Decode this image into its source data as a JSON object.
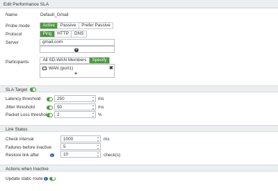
{
  "window": {
    "title": "Edit Performance SLA"
  },
  "form": {
    "name_label": "Name",
    "name_value": "Default_Gmail",
    "probe_mode": {
      "label": "Probe mode",
      "options": [
        "Active",
        "Passive",
        "Prefer Passive"
      ],
      "selected": "Active"
    },
    "protocol": {
      "label": "Protocol",
      "options": [
        "Ping",
        "HTTP",
        "DNS"
      ],
      "selected": "Ping"
    },
    "server": {
      "label": "Server",
      "value": "gmail.com",
      "second_value": ""
    },
    "participants": {
      "label": "Participants",
      "options": [
        "All SD-WAN Members",
        "Specify"
      ],
      "selected": "Specify",
      "members": [
        "WAN (port1)"
      ]
    }
  },
  "sla_target": {
    "header": "SLA Target",
    "enabled": true,
    "rows": [
      {
        "label": "Latency threshold",
        "value": "250",
        "unit": "ms",
        "enabled": true
      },
      {
        "label": "Jitter threshold",
        "value": "50",
        "unit": "ms",
        "enabled": true
      },
      {
        "label": "Packet Loss threshold",
        "value": "2",
        "unit": "%",
        "enabled": true
      }
    ]
  },
  "link_status": {
    "header": "Link Status",
    "rows": [
      {
        "label": "Check interval",
        "value": "1000",
        "unit": "ms"
      },
      {
        "label": "Failures before inactive",
        "value": "5",
        "unit": ""
      },
      {
        "label": "Restore link after",
        "value": "10",
        "unit": "check(s)"
      }
    ]
  },
  "actions_inactive": {
    "header": "Actions when Inactive",
    "update_static_route": {
      "label": "Update static route",
      "enabled": true
    }
  },
  "colors": {
    "accent_green": "#4a9b3b",
    "info_blue": "#2a62b5",
    "section_bg": "#eceef0"
  },
  "icons": {
    "info": "info-icon",
    "add": "plus-circle-icon",
    "remove": "close-icon",
    "interface": "port-icon"
  },
  "glyphs": {
    "plus": "+",
    "close": "✖",
    "info": "i"
  }
}
